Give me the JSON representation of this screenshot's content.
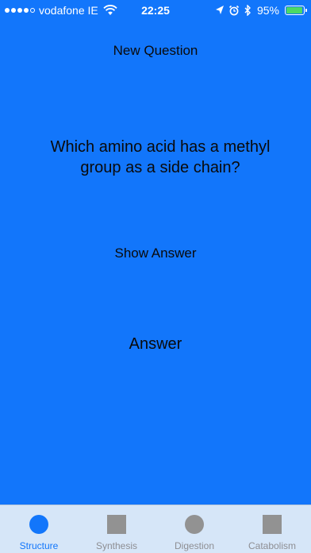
{
  "status_bar": {
    "carrier": "vodafone IE",
    "time": "22:25",
    "battery_percent": "95%",
    "signal_bars_filled": 4,
    "signal_bars_total": 5,
    "battery_level": 0.95,
    "icons": [
      "wifi-icon",
      "location-arrow-icon",
      "alarm-clock-icon",
      "bluetooth-icon",
      "battery-icon"
    ]
  },
  "main": {
    "new_question_label": "New Question",
    "question_text": "Which amino acid has a methyl group as a side chain?",
    "show_answer_label": "Show Answer",
    "answer_text": "Answer"
  },
  "tabs": [
    {
      "label": "Structure",
      "icon": "filled-circle-icon",
      "active": true
    },
    {
      "label": "Synthesis",
      "icon": "square-icon",
      "active": false
    },
    {
      "label": "Digestion",
      "icon": "circle-icon",
      "active": false
    },
    {
      "label": "Catabolism",
      "icon": "square-icon",
      "active": false
    }
  ],
  "colors": {
    "background": "#1276FB",
    "tab_bar": "#D6E6F8",
    "tab_active": "#1276FB",
    "tab_inactive": "#8E8E93",
    "battery": "#4CD964"
  }
}
